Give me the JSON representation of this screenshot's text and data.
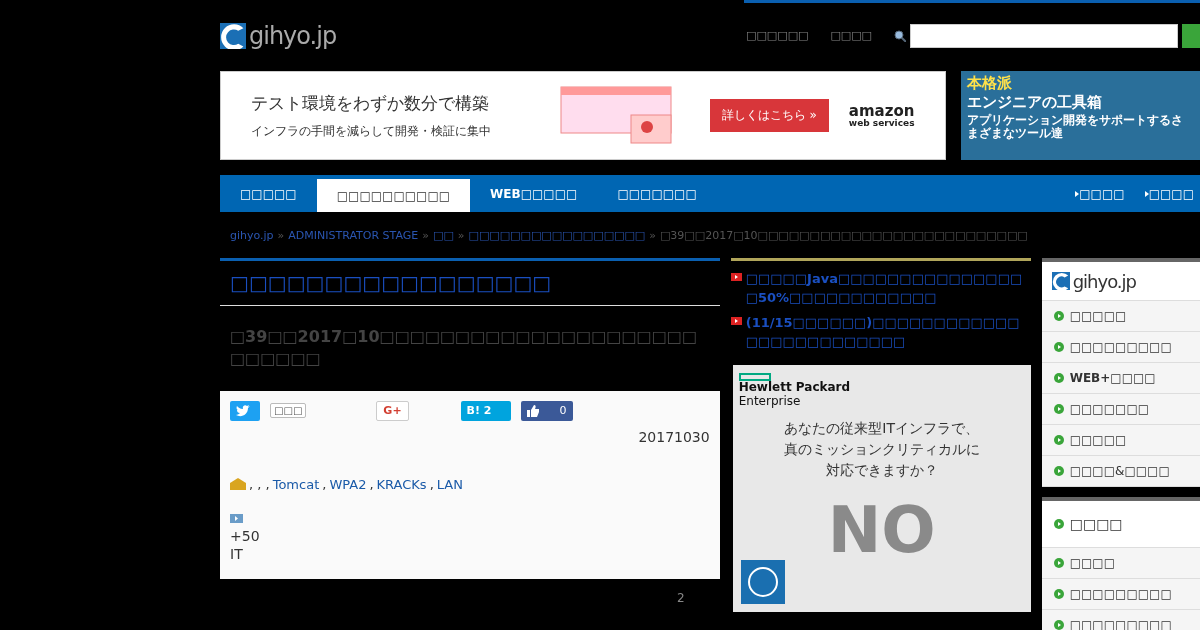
{
  "header": {
    "logo": "gihyo.jp",
    "links": [
      "□□□□□□",
      "□□□□"
    ]
  },
  "ad_banner": {
    "headline": "テスト環境をわずか数分で構築",
    "subline": "インフラの手間を減らして開発・検証に集中",
    "cta": "詳しくはこちら »",
    "brand": "amazon",
    "brand_sub": "web services"
  },
  "side_ad": {
    "line1": "本格派",
    "line2": "エンジニアの工具箱",
    "line3": "アプリケーション開発をサポートするさまざまなツール達"
  },
  "nav": {
    "tabs": [
      {
        "label": "□□□□□",
        "selected": false
      },
      {
        "label": "□□□□□□□□□□",
        "selected": true
      },
      {
        "label": "WEB□□□□□",
        "selected": false
      },
      {
        "label": "□□□□□□□",
        "selected": false
      }
    ],
    "links": [
      "□□□□",
      "□□□□"
    ]
  },
  "breadcrumb": {
    "links": [
      {
        "label": "gihyo.jp",
        "sep": "»"
      },
      {
        "label": "ADMINISTRATOR STAGE",
        "sep": "»"
      },
      {
        "label": "□□",
        "sep": "»"
      },
      {
        "label": "□□□□□□□□□□□□□□□□□",
        "sep": "»"
      }
    ],
    "current": "□39□□2017□10□□□□□□□□□□□□□□□□□□□□□□□□□□"
  },
  "article": {
    "series_title": "□□□□□□□□□□□□□□□□□",
    "title": "□39□□2017□10□□□□□□□□□□□□□□□□□□□□□□□□□□□",
    "share": [
      {
        "kind": "twitter",
        "count": "□□□"
      },
      {
        "kind": "gplus",
        "label": "G+"
      },
      {
        "kind": "hatena",
        "label": "B!",
        "count": "2"
      },
      {
        "kind": "like",
        "count": "0"
      }
    ],
    "date": "20171030",
    "tags_prefix": ", , , ",
    "tags": [
      {
        "label": "Tomcat",
        "sep": ","
      },
      {
        "label": "WPA2",
        "sep": ","
      },
      {
        "label": "KRACKs",
        "sep": ","
      },
      {
        "label": "LAN"
      }
    ],
    "lines": [
      "+50",
      "IT"
    ],
    "page": "2"
  },
  "news": [
    "□□□□□Java□□□□□□□□□□□□□□□□50%□□□□□□□□□□□□",
    "(11/15□□□□□□)□□□□□□□□□□□□□□□□□□□□□□□□□"
  ],
  "hpe_ad": {
    "brand": "Hewlett Packard",
    "brand_sub": "Enterprise",
    "copy": "あなたの従来型ITインフラで、真のミッションクリティカルに対応できますか？",
    "big": "NO"
  },
  "side_menu": {
    "logo": "gihyo.jp",
    "items": [
      "□□□□□",
      "□□□□□□□□□",
      "WEB+□□□□",
      "□□□□□□□",
      "□□□□□",
      "□□□□&□□□□"
    ]
  },
  "side_menu_2": {
    "title": "□□□□",
    "items": [
      "□□□□",
      "□□□□□□□□□",
      "□□□□□□□□□"
    ]
  }
}
